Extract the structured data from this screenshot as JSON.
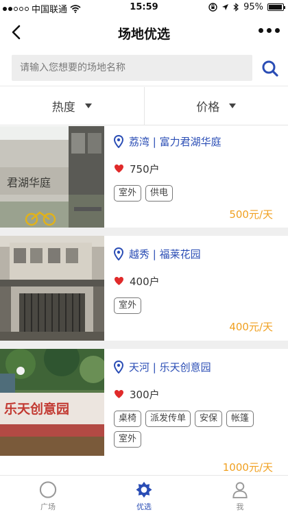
{
  "status": {
    "carrier": "中国联通",
    "time": "15:59",
    "battery": "95%",
    "battery_level": 0.95
  },
  "navbar": {
    "title": "场地优选"
  },
  "search": {
    "placeholder": "请输入您想要的场地名称"
  },
  "filters": [
    {
      "label": "热度"
    },
    {
      "label": "价格"
    }
  ],
  "venues": [
    {
      "location": "荔湾 | 富力君湖华庭",
      "heat": "750户",
      "tags": [
        "室外",
        "供电"
      ],
      "price": "500元/天",
      "sign_text": "君湖华庭"
    },
    {
      "location": "越秀 | 福莱花园",
      "heat": "400户",
      "tags": [
        "室外"
      ],
      "price": "400元/天"
    },
    {
      "location": "天河 | 乐天创意园",
      "heat": "300户",
      "tags": [
        "桌椅",
        "派发传单",
        "安保",
        "帐篷",
        "室外"
      ],
      "price": "1000元/天",
      "sign_text": "乐天创意园"
    }
  ],
  "tabs": [
    {
      "label": "广场"
    },
    {
      "label": "优选"
    },
    {
      "label": "我"
    }
  ],
  "colors": {
    "accent": "#2a4db5",
    "price": "#f0a020",
    "heart": "#e02a2a"
  }
}
